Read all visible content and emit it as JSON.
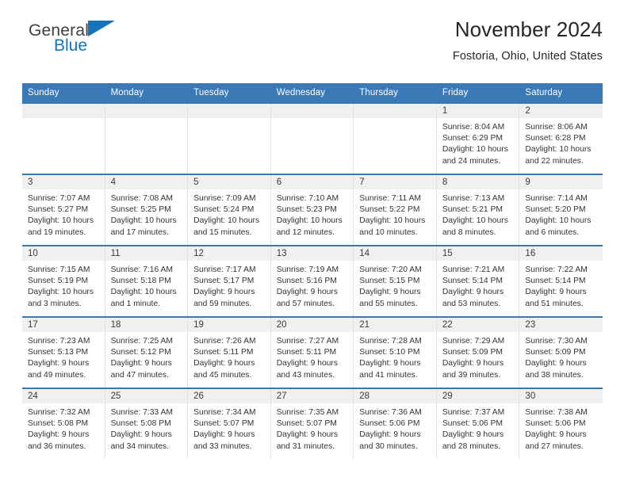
{
  "brand": {
    "name_part1": "General",
    "name_part2": "Blue",
    "triangle_icon": "triangle-icon",
    "accent_color": "#1574bb"
  },
  "header": {
    "title": "November 2024",
    "subtitle": "Fostoria, Ohio, United States"
  },
  "theme": {
    "header_blue": "#3b78b6",
    "day_band_gray": "#f0f0f0",
    "text": "#333333"
  },
  "weekdays": [
    "Sunday",
    "Monday",
    "Tuesday",
    "Wednesday",
    "Thursday",
    "Friday",
    "Saturday"
  ],
  "labels": {
    "sunrise": "Sunrise:",
    "sunset": "Sunset:",
    "daylight": "Daylight:"
  },
  "weeks": [
    [
      {
        "day": "",
        "empty": true
      },
      {
        "day": "",
        "empty": true
      },
      {
        "day": "",
        "empty": true
      },
      {
        "day": "",
        "empty": true
      },
      {
        "day": "",
        "empty": true
      },
      {
        "day": "1",
        "sunrise": "Sunrise: 8:04 AM",
        "sunset": "Sunset: 6:29 PM",
        "daylight": "Daylight: 10 hours and 24 minutes."
      },
      {
        "day": "2",
        "sunrise": "Sunrise: 8:06 AM",
        "sunset": "Sunset: 6:28 PM",
        "daylight": "Daylight: 10 hours and 22 minutes."
      }
    ],
    [
      {
        "day": "3",
        "sunrise": "Sunrise: 7:07 AM",
        "sunset": "Sunset: 5:27 PM",
        "daylight": "Daylight: 10 hours and 19 minutes."
      },
      {
        "day": "4",
        "sunrise": "Sunrise: 7:08 AM",
        "sunset": "Sunset: 5:25 PM",
        "daylight": "Daylight: 10 hours and 17 minutes."
      },
      {
        "day": "5",
        "sunrise": "Sunrise: 7:09 AM",
        "sunset": "Sunset: 5:24 PM",
        "daylight": "Daylight: 10 hours and 15 minutes."
      },
      {
        "day": "6",
        "sunrise": "Sunrise: 7:10 AM",
        "sunset": "Sunset: 5:23 PM",
        "daylight": "Daylight: 10 hours and 12 minutes."
      },
      {
        "day": "7",
        "sunrise": "Sunrise: 7:11 AM",
        "sunset": "Sunset: 5:22 PM",
        "daylight": "Daylight: 10 hours and 10 minutes."
      },
      {
        "day": "8",
        "sunrise": "Sunrise: 7:13 AM",
        "sunset": "Sunset: 5:21 PM",
        "daylight": "Daylight: 10 hours and 8 minutes."
      },
      {
        "day": "9",
        "sunrise": "Sunrise: 7:14 AM",
        "sunset": "Sunset: 5:20 PM",
        "daylight": "Daylight: 10 hours and 6 minutes."
      }
    ],
    [
      {
        "day": "10",
        "sunrise": "Sunrise: 7:15 AM",
        "sunset": "Sunset: 5:19 PM",
        "daylight": "Daylight: 10 hours and 3 minutes."
      },
      {
        "day": "11",
        "sunrise": "Sunrise: 7:16 AM",
        "sunset": "Sunset: 5:18 PM",
        "daylight": "Daylight: 10 hours and 1 minute."
      },
      {
        "day": "12",
        "sunrise": "Sunrise: 7:17 AM",
        "sunset": "Sunset: 5:17 PM",
        "daylight": "Daylight: 9 hours and 59 minutes."
      },
      {
        "day": "13",
        "sunrise": "Sunrise: 7:19 AM",
        "sunset": "Sunset: 5:16 PM",
        "daylight": "Daylight: 9 hours and 57 minutes."
      },
      {
        "day": "14",
        "sunrise": "Sunrise: 7:20 AM",
        "sunset": "Sunset: 5:15 PM",
        "daylight": "Daylight: 9 hours and 55 minutes."
      },
      {
        "day": "15",
        "sunrise": "Sunrise: 7:21 AM",
        "sunset": "Sunset: 5:14 PM",
        "daylight": "Daylight: 9 hours and 53 minutes."
      },
      {
        "day": "16",
        "sunrise": "Sunrise: 7:22 AM",
        "sunset": "Sunset: 5:14 PM",
        "daylight": "Daylight: 9 hours and 51 minutes."
      }
    ],
    [
      {
        "day": "17",
        "sunrise": "Sunrise: 7:23 AM",
        "sunset": "Sunset: 5:13 PM",
        "daylight": "Daylight: 9 hours and 49 minutes."
      },
      {
        "day": "18",
        "sunrise": "Sunrise: 7:25 AM",
        "sunset": "Sunset: 5:12 PM",
        "daylight": "Daylight: 9 hours and 47 minutes."
      },
      {
        "day": "19",
        "sunrise": "Sunrise: 7:26 AM",
        "sunset": "Sunset: 5:11 PM",
        "daylight": "Daylight: 9 hours and 45 minutes."
      },
      {
        "day": "20",
        "sunrise": "Sunrise: 7:27 AM",
        "sunset": "Sunset: 5:11 PM",
        "daylight": "Daylight: 9 hours and 43 minutes."
      },
      {
        "day": "21",
        "sunrise": "Sunrise: 7:28 AM",
        "sunset": "Sunset: 5:10 PM",
        "daylight": "Daylight: 9 hours and 41 minutes."
      },
      {
        "day": "22",
        "sunrise": "Sunrise: 7:29 AM",
        "sunset": "Sunset: 5:09 PM",
        "daylight": "Daylight: 9 hours and 39 minutes."
      },
      {
        "day": "23",
        "sunrise": "Sunrise: 7:30 AM",
        "sunset": "Sunset: 5:09 PM",
        "daylight": "Daylight: 9 hours and 38 minutes."
      }
    ],
    [
      {
        "day": "24",
        "sunrise": "Sunrise: 7:32 AM",
        "sunset": "Sunset: 5:08 PM",
        "daylight": "Daylight: 9 hours and 36 minutes."
      },
      {
        "day": "25",
        "sunrise": "Sunrise: 7:33 AM",
        "sunset": "Sunset: 5:08 PM",
        "daylight": "Daylight: 9 hours and 34 minutes."
      },
      {
        "day": "26",
        "sunrise": "Sunrise: 7:34 AM",
        "sunset": "Sunset: 5:07 PM",
        "daylight": "Daylight: 9 hours and 33 minutes."
      },
      {
        "day": "27",
        "sunrise": "Sunrise: 7:35 AM",
        "sunset": "Sunset: 5:07 PM",
        "daylight": "Daylight: 9 hours and 31 minutes."
      },
      {
        "day": "28",
        "sunrise": "Sunrise: 7:36 AM",
        "sunset": "Sunset: 5:06 PM",
        "daylight": "Daylight: 9 hours and 30 minutes."
      },
      {
        "day": "29",
        "sunrise": "Sunrise: 7:37 AM",
        "sunset": "Sunset: 5:06 PM",
        "daylight": "Daylight: 9 hours and 28 minutes."
      },
      {
        "day": "30",
        "sunrise": "Sunrise: 7:38 AM",
        "sunset": "Sunset: 5:06 PM",
        "daylight": "Daylight: 9 hours and 27 minutes."
      }
    ]
  ]
}
